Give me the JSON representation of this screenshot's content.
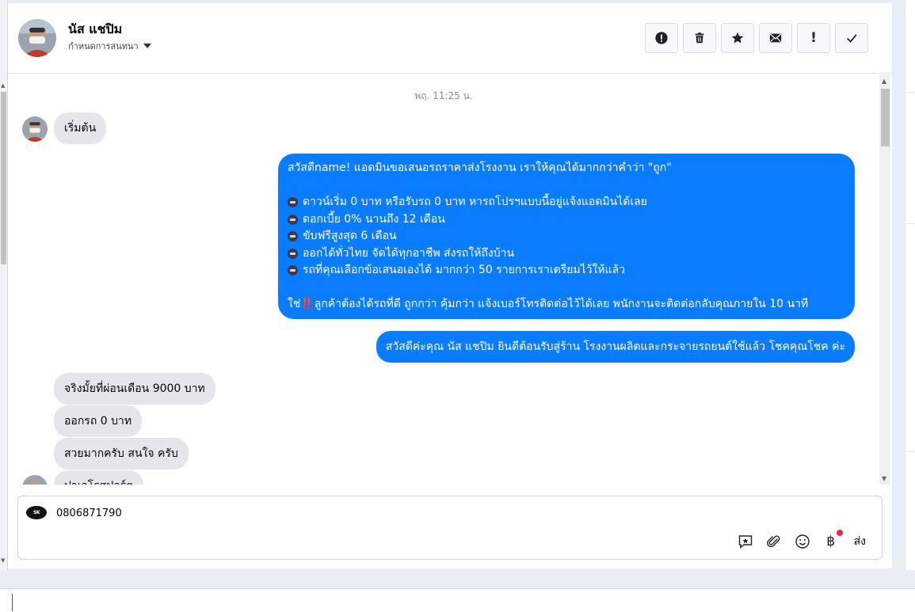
{
  "conversation": {
    "contact_name": "นัส แชปิม",
    "assign_label": "กำหนดการสนทนา"
  },
  "toolbar": {
    "icons": [
      "alert-icon",
      "trash-icon",
      "star-icon",
      "envelope-icon",
      "exclamation-icon",
      "check-icon"
    ],
    "exclamation_label": "!"
  },
  "chat": {
    "timestamp": "พฤ. 11:25 น.",
    "incoming_start": "เริ่มต้น",
    "outgoing_offer": {
      "line1": "สวัสดีname! แอดมินขอเสนอรถราคาส่งโรงงาน เราให้คุณได้มากกว่าคำว่า \"ถูก\"",
      "bullets": [
        "ดาวน์เริ่ม 0 บาท หรือรับรถ 0 บาท หารถโปรฯแบบนี้อยู่แจ้งแอดมินได้เลย",
        "ดอกเบี้ย 0% นานถึง 12 เดือน",
        "ขับฟรีสูงสุด 6 เดือน",
        "ออกได้ทั่วไทย จัดได้ทุกอาชีพ ส่งรถให้ถึงบ้าน",
        "รถที่คุณเลือกข้อเสนอเองได้ มากกว่า 50 รายการเราเตรียมไว้ให้แล้ว"
      ],
      "closing_prefix": "ใช่",
      "closing_mark": "‼️",
      "closing_text": "ลูกค้าต้องได้รถที่ดี ถูกกว่า คุ้มกว่า แจ้งเบอร์โทรติดต่อไว้ได้เลย พนักงานจะติดต่อกลับคุณภายใน 10 นาที"
    },
    "outgoing_welcome": "สวัสดีค่ะคุณ นัส แชปิม ยินดีต้อนรับสู่ร้าน โรงงานผลิตและกระจายรถยนต์ใช้แล้ว โชคคุณโชค ค่ะ",
    "incoming_messages": [
      "จริงมั้ยที่ผ่อนเดือน 9000 บาท",
      "ออกรถ 0 บาท",
      "สวยมากครับ สนใจ ครับ",
      "ปาเจโรสปอร์ต"
    ]
  },
  "composer": {
    "page_logo_text": "SK",
    "input_value": "0806871790",
    "tool_icons": [
      "quick-reply-icon",
      "paperclip-icon",
      "emoji-icon",
      "baht-payment-icon"
    ],
    "baht_symbol": "฿",
    "send_label": "ส่ง"
  },
  "colors": {
    "outgoing_bubble": "#0a7cff",
    "incoming_bubble": "#e4e6eb",
    "notification_dot": "#f02849"
  }
}
